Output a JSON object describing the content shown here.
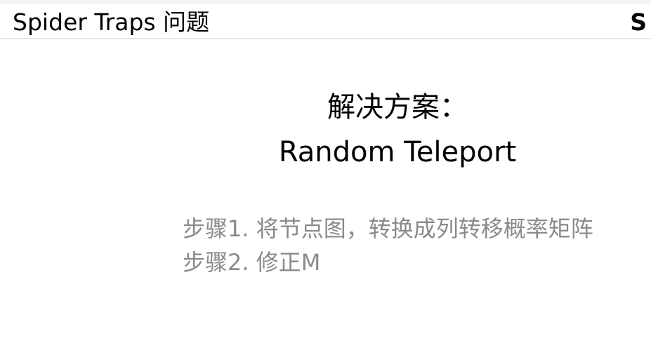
{
  "header": {
    "title": "Spider Traps 问题",
    "right_label": "S"
  },
  "solution": {
    "heading": "解决方案：",
    "subheading": "Random Teleport"
  },
  "steps": [
    "步骤1. 将节点图，转换成列转移概率矩阵",
    "步骤2. 修正M"
  ],
  "colors": {
    "title_text": "#000000",
    "step_text": "#8a8a8a",
    "header_rule": "#e6e6e6",
    "background": "#ffffff"
  }
}
